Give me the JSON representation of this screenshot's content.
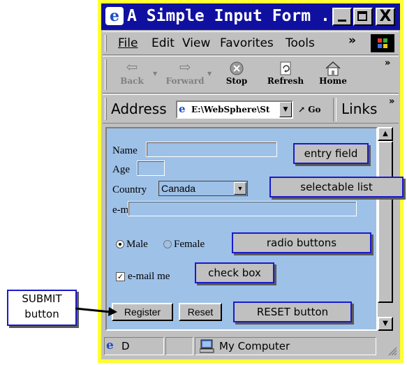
{
  "window": {
    "title": "A Simple Input Form ...",
    "minimize": "_",
    "maximize": "□",
    "close": "X"
  },
  "menu": {
    "items": [
      "File",
      "Edit",
      "View",
      "Favorites",
      "Tools"
    ],
    "more": "»"
  },
  "toolbar": {
    "buttons": [
      {
        "label": "Back",
        "icon": "back-arrow-icon",
        "enabled": false
      },
      {
        "label": "Forward",
        "icon": "forward-arrow-icon",
        "enabled": false
      },
      {
        "label": "Stop",
        "icon": "stop-icon",
        "enabled": true
      },
      {
        "label": "Refresh",
        "icon": "refresh-icon",
        "enabled": true
      },
      {
        "label": "Home",
        "icon": "home-icon",
        "enabled": true
      }
    ],
    "more": "»"
  },
  "address": {
    "label": "Address",
    "value": "E:\\WebSphere\\St",
    "go": "Go",
    "links": "Links",
    "more": "»"
  },
  "form": {
    "name_label": "Name",
    "age_label": "Age",
    "country_label": "Country",
    "country_value": "Canada",
    "email_label": "e-mail",
    "radio_male": "Male",
    "radio_female": "Female",
    "radio_selected": "Male",
    "checkbox_label": "e-mail me",
    "checkbox_checked": true,
    "register": "Register",
    "reset": "Reset"
  },
  "annotations": {
    "entry_field": "entry field",
    "selectable_list": "selectable list",
    "radio_buttons": "radio buttons",
    "check_box": "check box",
    "reset_button": "RESET button",
    "submit_line1": "SUBMIT",
    "submit_line2": "button"
  },
  "status": {
    "left_text": "D",
    "zone": "My Computer"
  },
  "colors": {
    "frame": "#ffff33",
    "title_bar": "#1010a0",
    "page_bg": "#9ec1e8",
    "annotation_border": "#1a1acc"
  }
}
